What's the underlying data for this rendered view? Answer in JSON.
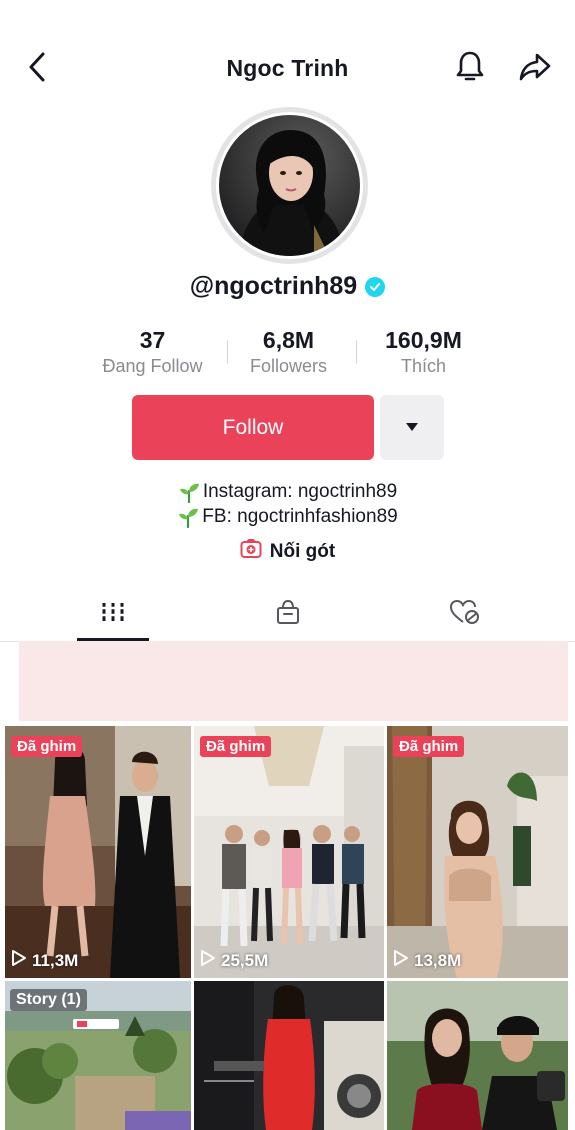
{
  "header": {
    "title": "Ngoc Trinh",
    "back_icon": "chevron-left-icon",
    "bell_icon": "bell-icon",
    "share_icon": "share-icon"
  },
  "profile": {
    "username": "@ngoctrinh89",
    "verified": true,
    "verified_color": "#20d5ec"
  },
  "stats": [
    {
      "value": "37",
      "label": "Đang Follow"
    },
    {
      "value": "6,8M",
      "label": "Followers"
    },
    {
      "value": "160,9M",
      "label": "Thích"
    }
  ],
  "actions": {
    "follow_label": "Follow",
    "follow_color": "#ea4359",
    "more_icon": "caret-down-icon"
  },
  "bio": {
    "lines": [
      "Instagram: ngoctrinh89",
      "FB: ngoctrinhfashion89"
    ],
    "link_label": "Nối gót",
    "link_icon": "plus-square-icon"
  },
  "tabs": [
    {
      "icon": "grid-icon",
      "active": true
    },
    {
      "icon": "shopping-bag-icon",
      "active": false
    },
    {
      "icon": "hidden-heart-icon",
      "active": false
    }
  ],
  "grid": {
    "videos": [
      {
        "badge": "Đã ghim",
        "views": "11,3M"
      },
      {
        "badge": "Đã ghim",
        "views": "25,5M"
      },
      {
        "badge": "Đã ghim",
        "views": "13,8M"
      },
      {
        "badge": "Story (1)",
        "views": ""
      },
      {
        "badge": "",
        "views": ""
      },
      {
        "badge": "",
        "views": ""
      }
    ]
  }
}
